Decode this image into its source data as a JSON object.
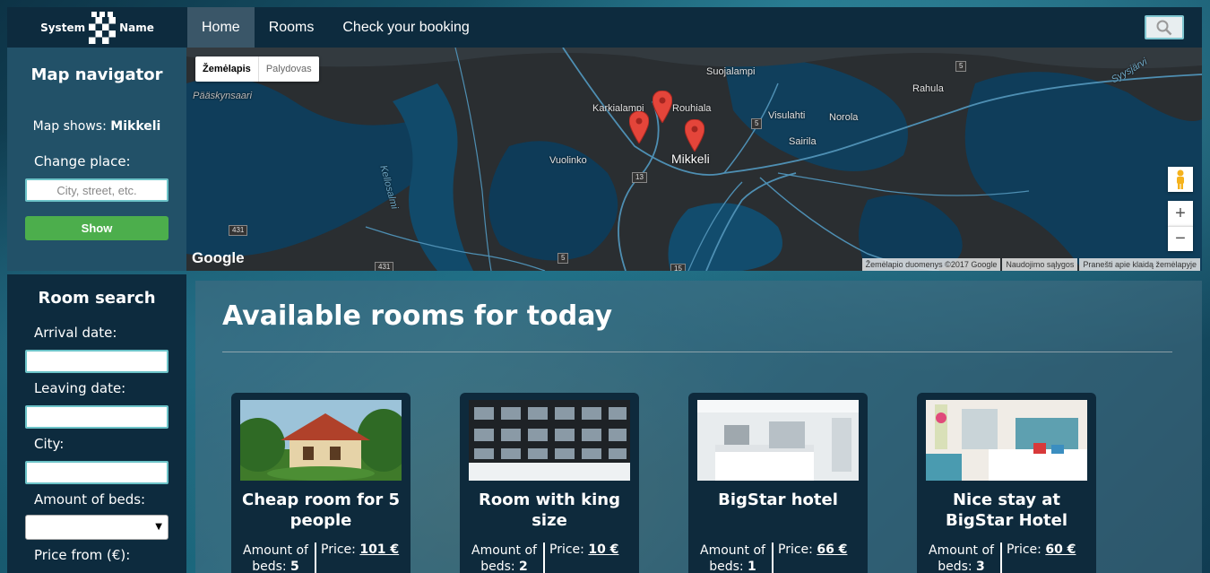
{
  "brand": {
    "left": "System",
    "right": "Name"
  },
  "nav": {
    "items": [
      {
        "label": "Home",
        "active": true
      },
      {
        "label": "Rooms",
        "active": false
      },
      {
        "label": "Check your booking",
        "active": false
      }
    ]
  },
  "map_navigator": {
    "title": "Map navigator",
    "shows_label": "Map shows:",
    "shows_value": "Mikkeli",
    "change_label": "Change place:",
    "input_placeholder": "City, street, etc.",
    "show_button": "Show"
  },
  "room_search": {
    "title": "Room search",
    "arrival_label": "Arrival date:",
    "leaving_label": "Leaving date:",
    "city_label": "City:",
    "beds_label": "Amount of beds:",
    "price_label": "Price from (€):"
  },
  "map": {
    "type_map": "Žemėlapis",
    "type_satellite": "Palydovas",
    "places": [
      "Pääskynsaari",
      "Karkialampi",
      "Rouhiala",
      "Suojalampi",
      "Rahula",
      "Visulahti",
      "Norola",
      "Sairila",
      "Vuolinko",
      "Mikkeli",
      "Kellosalmi",
      "Syysjärvi"
    ],
    "roads": [
      "431",
      "431",
      "5",
      "5",
      "5",
      "13",
      "15"
    ],
    "footer": [
      "Žemėlapio duomenys ©2017 Google",
      "Naudojimo sąlygos",
      "Pranešti apie klaidą žemėlapyje"
    ],
    "google": "Google",
    "zoom_in": "+",
    "zoom_out": "−"
  },
  "content": {
    "title": "Available rooms for today",
    "cards": [
      {
        "title": "Cheap room for 5 people",
        "beds_label": "Amount of beds:",
        "beds": "5",
        "price_label": "Price:",
        "price": "101 €"
      },
      {
        "title": "Room with king size",
        "beds_label": "Amount of beds:",
        "beds": "2",
        "price_label": "Price:",
        "price": "10 €"
      },
      {
        "title": "BigStar hotel",
        "beds_label": "Amount of beds:",
        "beds": "1",
        "price_label": "Price:",
        "price": "66 €"
      },
      {
        "title": "Nice stay at BigStar Hotel",
        "beds_label": "Amount of beds:",
        "beds": "3",
        "price_label": "Price:",
        "price": "60 €"
      }
    ]
  },
  "colors": {
    "nav_bg": "#0d2b3e",
    "active_nav": "#3a5668",
    "show_button": "#4cae4c",
    "pin": "#e4453a"
  }
}
